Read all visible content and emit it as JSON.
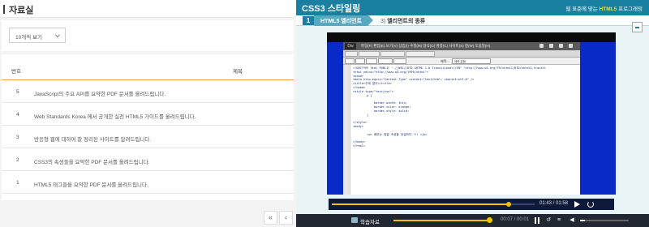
{
  "left": {
    "title": "자료실",
    "filter": {
      "selected": "10개씩 보기"
    },
    "list": {
      "headers": {
        "no": "번호",
        "title": "제목"
      },
      "rows": [
        {
          "no": "5",
          "title": "JavaScript의 주요 API를 요약한 PDF 문서를 올려드립니다."
        },
        {
          "no": "4",
          "title": "Web Standards Korea 에서 공개한 실전 HTML5 가이드를 올려드립니다."
        },
        {
          "no": "3",
          "title": "반응형 웹에 대하여 잘 정리된 사이트를 알려드립니다."
        },
        {
          "no": "2",
          "title": "CSS3의 속성들을 요약한 PDF 문서를 올려드립니다."
        },
        {
          "no": "1",
          "title": "HTML5 태그들을 요약한 PDF 문서를 올려드립니다."
        }
      ]
    },
    "pagination": {
      "first": "«",
      "prev": "‹"
    }
  },
  "right": {
    "app_title": "CSS3 스타일링",
    "tagline_pre": "웹 표준에 맞는 ",
    "tagline_hl": "HTML5",
    "tagline_post": " 프로그래밍",
    "chapter_num": "1",
    "chapter": "HTML5 엘리먼트",
    "section_pre": "3)",
    "section": "엘리먼트의 종류",
    "video": {
      "editor_menu": "파일(F)  편집(E)  보기(V)  삽입(I)  수정(M)  형식(O)  명령(C)  사이트(S)  창(W)  도움말(H)",
      "editor_logo": "Dw",
      "toolbar_title_label": "제목:",
      "toolbar_title_value": "제목 없음",
      "code": "<!DOCTYPE html PUBLIC \"-//W3C//DTD XHTML 1.0 Transitional//EN\" \"http://www.w3.org/TR/xhtml1/DTD/xhtml1-transit\n<html xmlns=\"http://www.w3.org/1999/xhtml\">\n<head>\n<meta http-equiv=\"Content-Type\" content=\"text/html; charset=utf-8\" />\n<title>주제 없이</title>\n</head>\n<style type=\"text/css\">\n        p {\n\n            border-width: thin;\n            border-color: orange;\n            border-style: solid;\n        }\n\n</style>\n<body>\n\n        <p> 배우는 정말 속성을 공실하다 !!! </p>\n\n</body>\n</html>",
      "time": "01:43 / 01:58",
      "progress": 0.87
    },
    "bottom": {
      "memo_label": "학습자료",
      "time": "00:07 / 00:01",
      "progress": 0.98,
      "volume": 0.1
    }
  }
}
